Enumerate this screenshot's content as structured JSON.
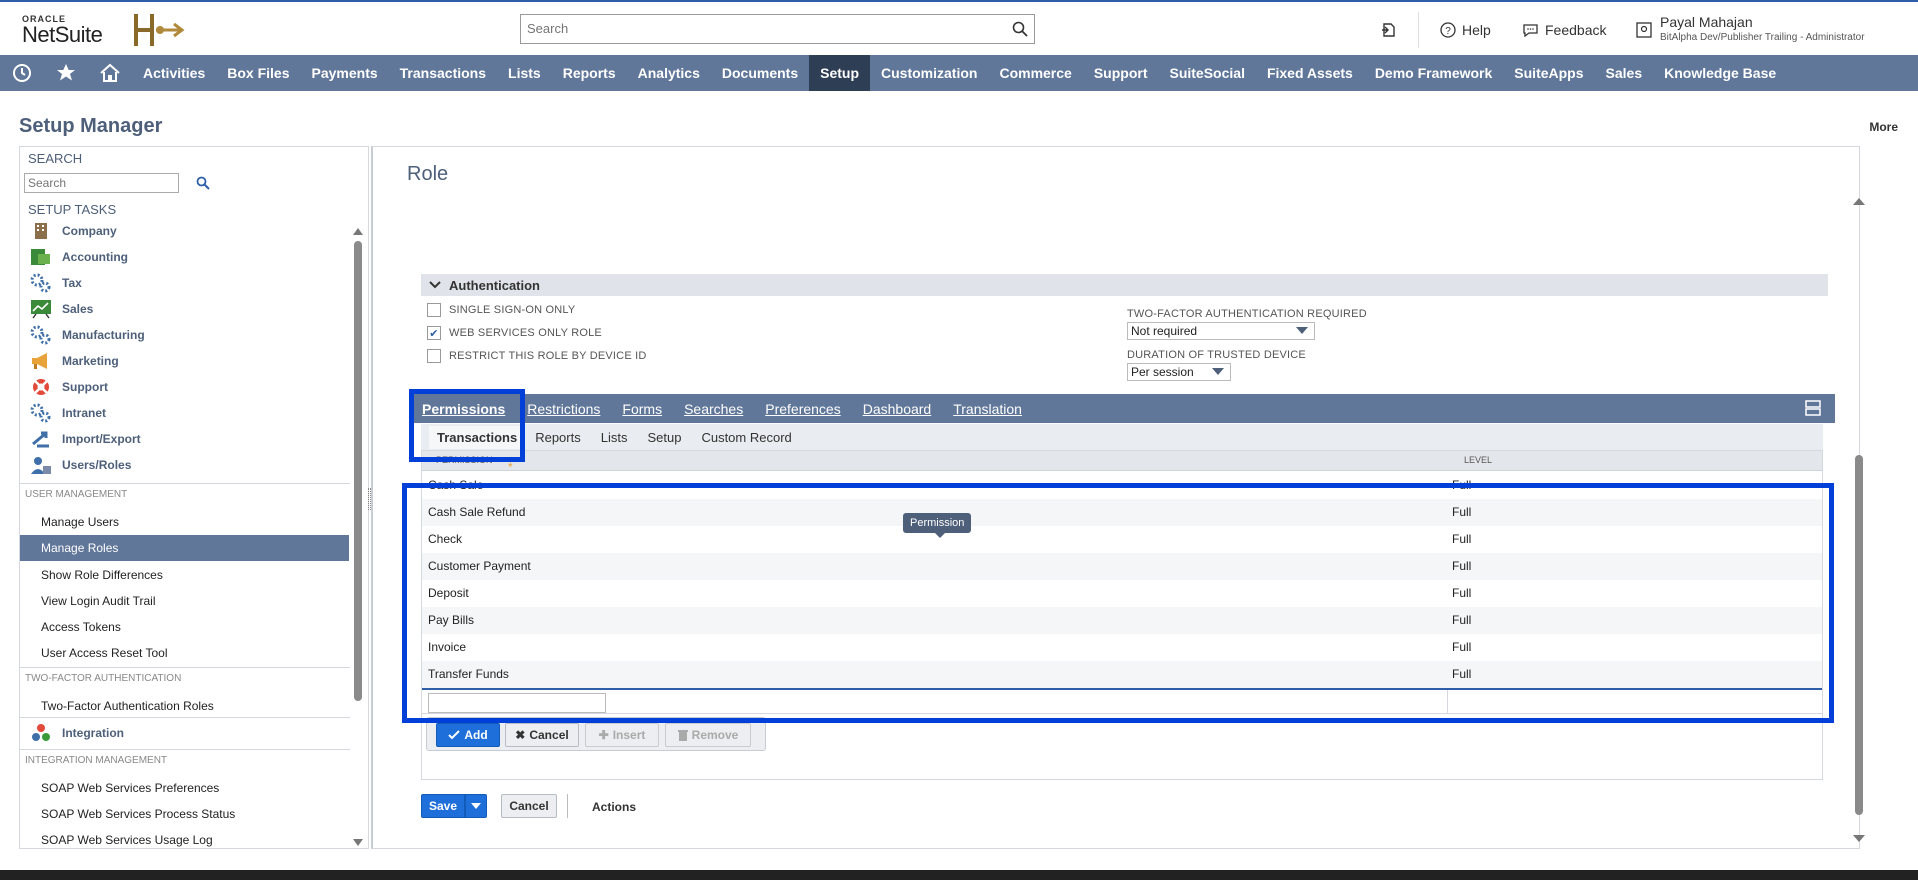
{
  "header": {
    "oracle": "ORACLE",
    "netsuite": "NetSuite",
    "search_placeholder": "Search",
    "help": "Help",
    "feedback": "Feedback",
    "user_name": "Payal Mahajan",
    "user_role": "BitAlpha Dev/Publisher Trailing - Administrator"
  },
  "nav": {
    "tabs": [
      "Activities",
      "Box Files",
      "Payments",
      "Transactions",
      "Lists",
      "Reports",
      "Analytics",
      "Documents",
      "Setup",
      "Customization",
      "Commerce",
      "Support",
      "SuiteSocial",
      "Fixed Assets",
      "Demo Framework",
      "SuiteApps",
      "Sales",
      "Knowledge Base"
    ],
    "active": "Setup"
  },
  "page": {
    "title": "Setup Manager",
    "more": "More"
  },
  "sidebar": {
    "search_title": "SEARCH",
    "search_placeholder": "Search",
    "tasks_title": "SETUP TASKS",
    "tasks": [
      "Company",
      "Accounting",
      "Tax",
      "Sales",
      "Manufacturing",
      "Marketing",
      "Support",
      "Intranet",
      "Import/Export",
      "Users/Roles"
    ],
    "user_mgmt_title": "USER MANAGEMENT",
    "user_mgmt_links": [
      "Manage Users",
      "Manage Roles",
      "Show Role Differences",
      "View Login Audit Trail",
      "Access Tokens",
      "User Access Reset Tool"
    ],
    "tfa_title": "TWO-FACTOR AUTHENTICATION",
    "tfa_links": [
      "Two-Factor Authentication Roles"
    ],
    "integration": "Integration",
    "int_mgmt_title": "INTEGRATION MANAGEMENT",
    "int_links": [
      "SOAP Web Services Preferences",
      "SOAP Web Services Process Status",
      "SOAP Web Services Usage Log"
    ]
  },
  "role": {
    "title": "Role",
    "auth_section": "Authentication",
    "sso": "SINGLE SIGN-ON ONLY",
    "ws_only": "WEB SERVICES ONLY ROLE",
    "restrict_device": "RESTRICT THIS ROLE BY DEVICE ID",
    "tfa_label": "TWO-FACTOR AUTHENTICATION REQUIRED",
    "tfa_value": "Not required",
    "duration_label": "DURATION OF TRUSTED DEVICE",
    "duration_value": "Per session",
    "ws_only_checked": true
  },
  "tabs": [
    "Permissions",
    "Restrictions",
    "Forms",
    "Searches",
    "Preferences",
    "Dashboard",
    "Translation"
  ],
  "subtabs": [
    "Transactions",
    "Reports",
    "Lists",
    "Setup",
    "Custom Record"
  ],
  "grid": {
    "col_permission": "PERMISSION",
    "col_level": "LEVEL",
    "rows": [
      {
        "permission": "Cash Sale",
        "level": "Full"
      },
      {
        "permission": "Cash Sale Refund",
        "level": "Full"
      },
      {
        "permission": "Check",
        "level": "Full"
      },
      {
        "permission": "Customer Payment",
        "level": "Full"
      },
      {
        "permission": "Deposit",
        "level": "Full"
      },
      {
        "permission": "Pay Bills",
        "level": "Full"
      },
      {
        "permission": "Invoice",
        "level": "Full"
      },
      {
        "permission": "Transfer Funds",
        "level": "Full"
      }
    ],
    "tooltip": "Permission"
  },
  "grid_buttons": {
    "add": "Add",
    "cancel": "Cancel",
    "insert": "Insert",
    "remove": "Remove"
  },
  "form_buttons": {
    "save": "Save",
    "cancel": "Cancel",
    "actions": "Actions"
  },
  "colors": {
    "nav": "#607799",
    "nav_active": "#2e3e55",
    "highlight": "#0040d8",
    "primary": "#1e6fd9"
  }
}
